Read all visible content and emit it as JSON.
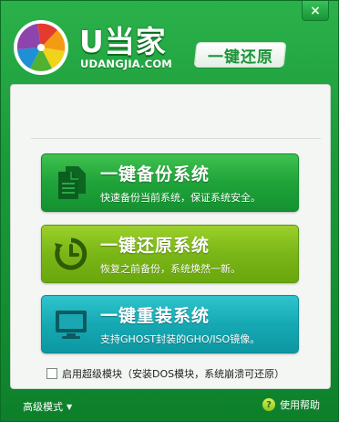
{
  "window": {
    "close_label": "×"
  },
  "brand": {
    "name": "U当家",
    "domain": "UDANGJIA.COM",
    "product_badge": "一键还原"
  },
  "actions": [
    {
      "id": "backup",
      "title": "一键备份系统",
      "subtitle": "快速备份当前系统，保证系统安全。",
      "icon": "documents-icon"
    },
    {
      "id": "restore",
      "title": "一键还原系统",
      "subtitle": "恢复之前备份，系统焕然一新。",
      "icon": "restore-clock-icon"
    },
    {
      "id": "reinstall",
      "title": "一键重装系统",
      "subtitle": "支持GHOST封装的GHO/ISO镜像。",
      "icon": "monitor-icon"
    }
  ],
  "super_mode": {
    "checked": false,
    "label": "启用超级模块（安装DOS模块，系统崩溃可还原）"
  },
  "footer": {
    "advanced_label": "高级模式",
    "help_label": "使用帮助"
  },
  "colors": {
    "window_green": "#1a9a3a",
    "backup_green": "#1fa339",
    "restore_lime": "#7ab617",
    "reinstall_cyan": "#16a9b3"
  }
}
